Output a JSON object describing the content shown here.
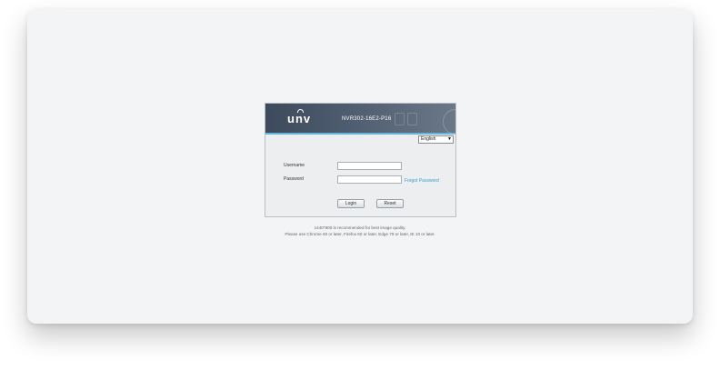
{
  "brand": {
    "logo_text": "unv"
  },
  "device": {
    "model": "NVR302-16E2-P16"
  },
  "language_select": {
    "selected": "English",
    "icon": "chevron-down-icon"
  },
  "form": {
    "username_label": "Username",
    "password_label": "Password",
    "username_value": "",
    "password_value": "",
    "forgot_link": "Forgot Password"
  },
  "buttons": {
    "login": "Login",
    "reset": "Reset"
  },
  "notes": {
    "resolution": "1440*900 is recommended for best image quality.",
    "browsers": "Please use Chrome 60 or later, Firefox 60 or later, Edge 79 or later, IE 10 or later."
  },
  "colors": {
    "header": "#3c4a5c",
    "accent_line": "#62b6d9",
    "link": "#3a9fd0"
  }
}
